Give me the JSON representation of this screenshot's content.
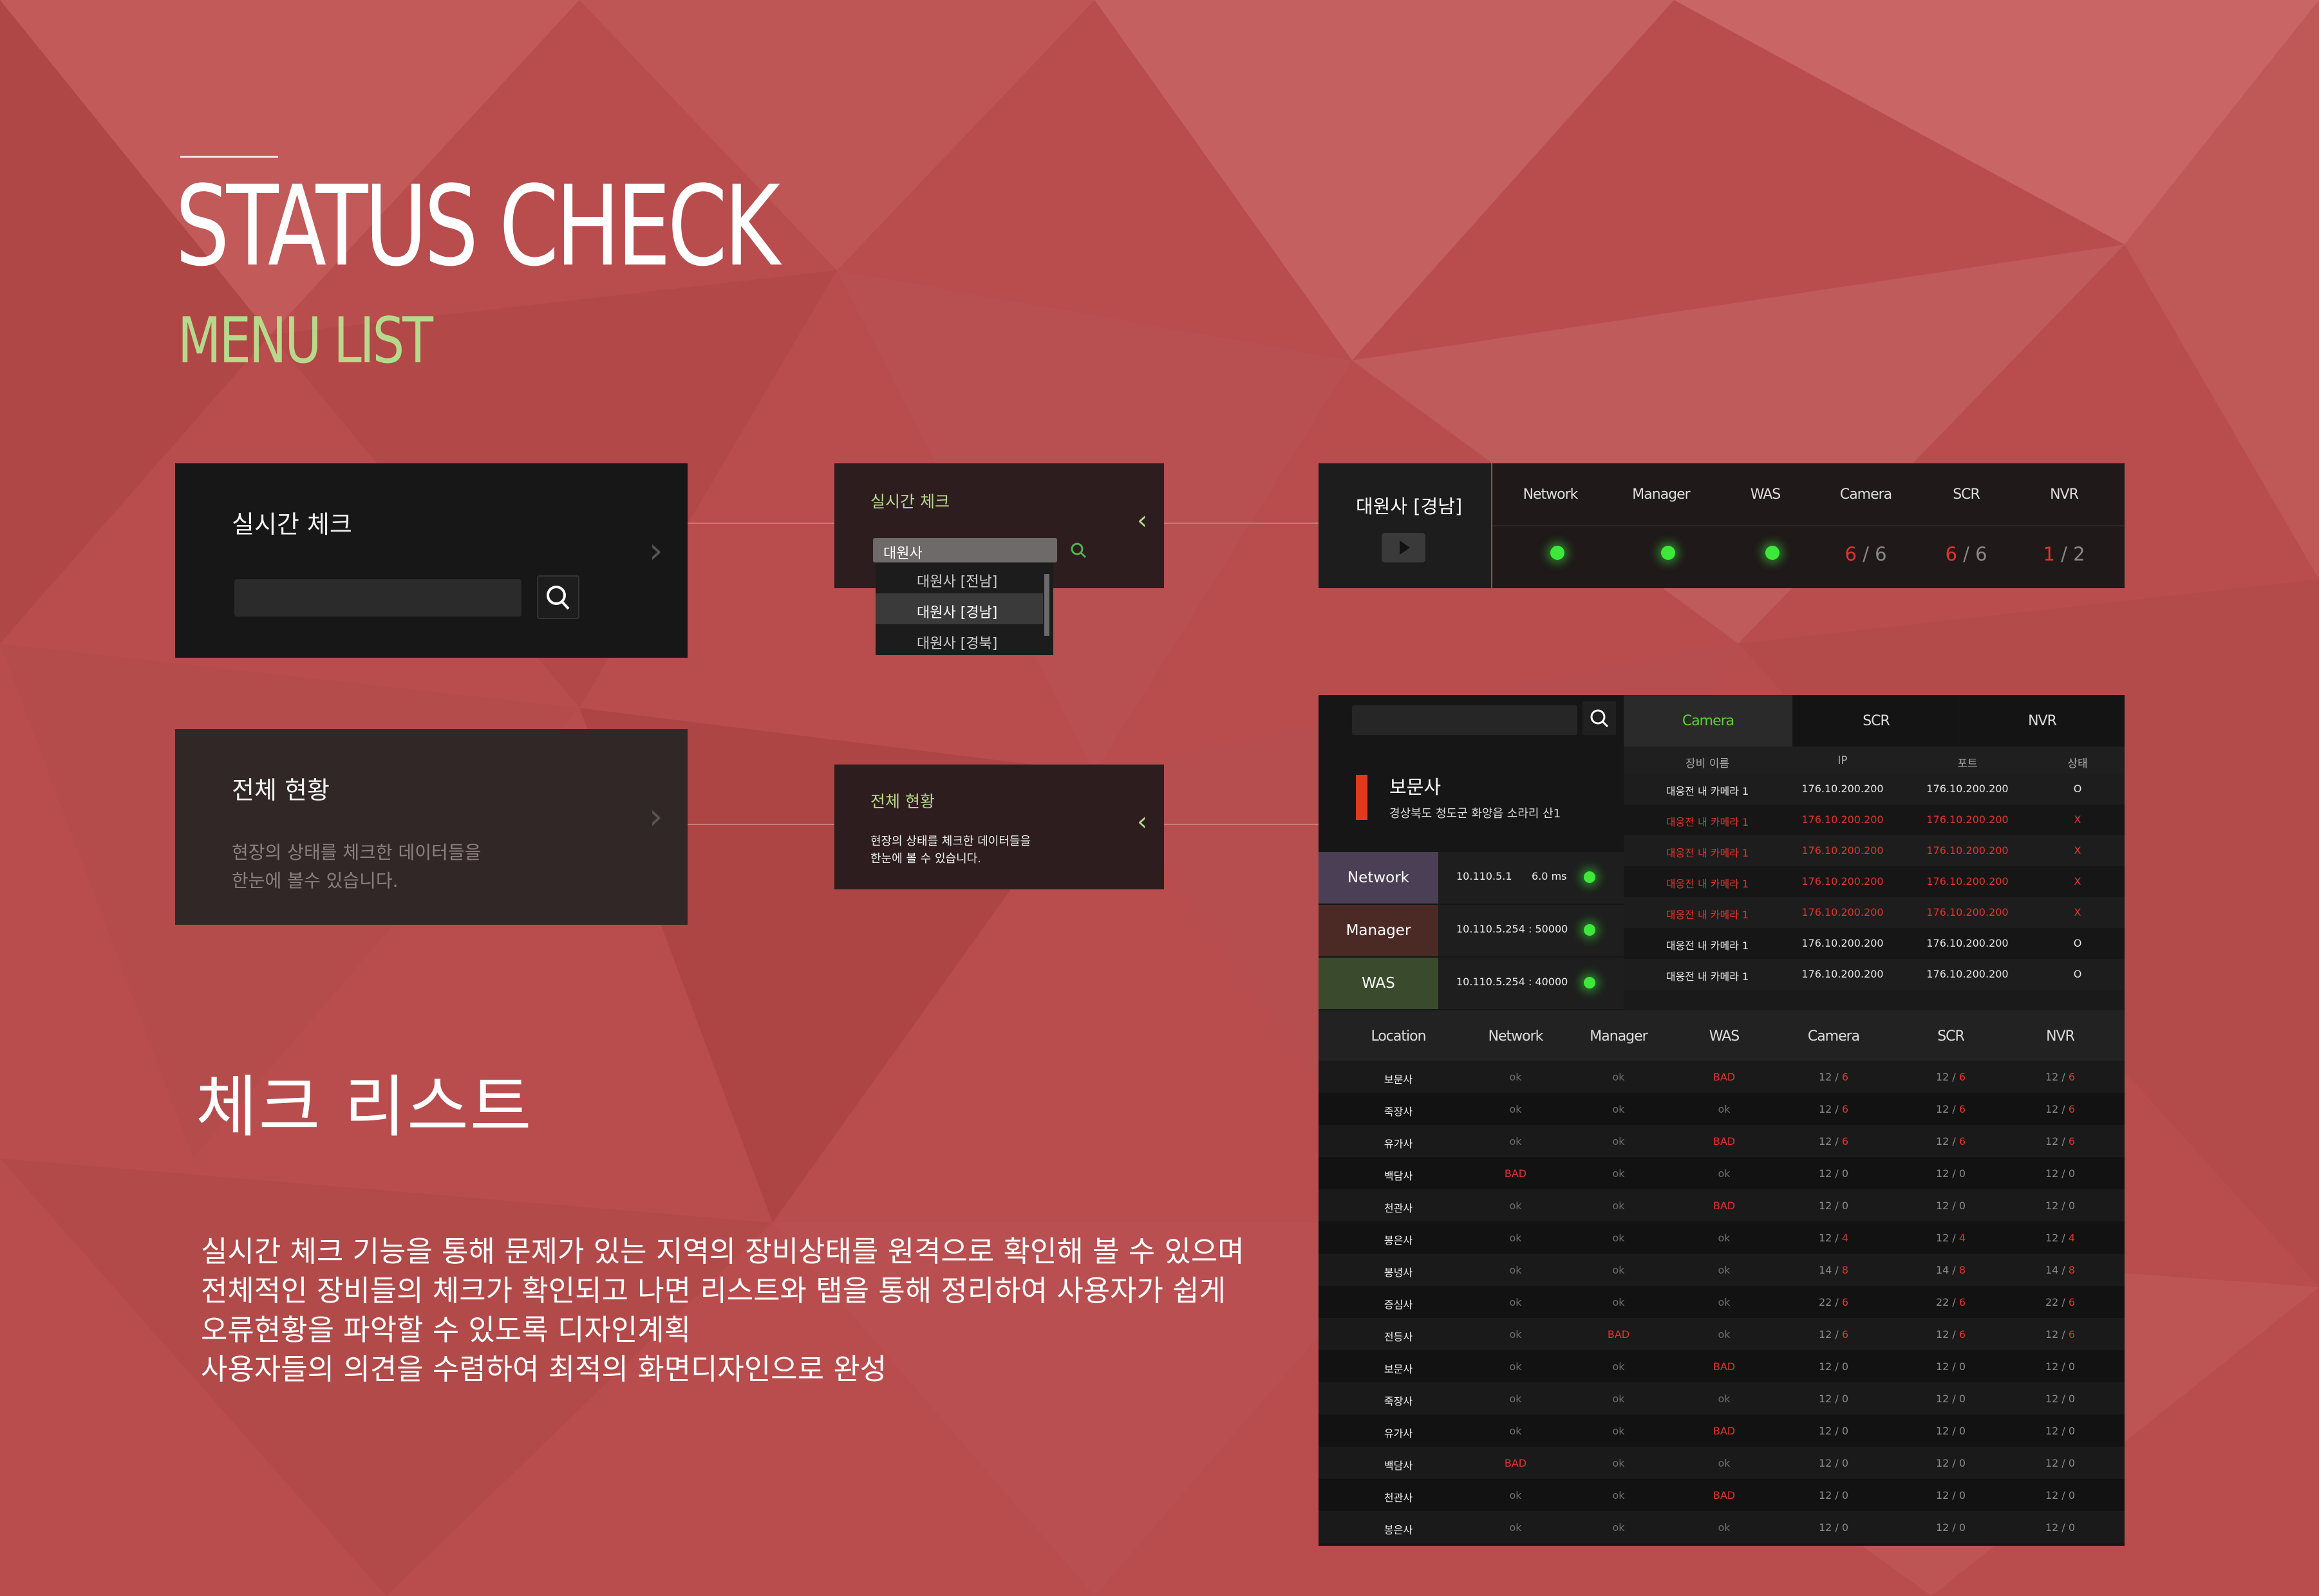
{
  "heading": {
    "title": "STATUS CHECK",
    "subtitle": "MENU LIST",
    "check_title": "체크 리스트",
    "description": [
      "실시간 체크 기능을 통해 문제가 있는 지역의 장비상태를 원격으로 확인해 볼 수 있으며",
      "전체적인 장비들의 체크가 확인되고 나면 리스트와 탭을 통해 정리하여 사용자가 쉽게",
      "오류현황을 파악할 수 있도록 디자인계획",
      "사용자들의 의견을 수렴하여 최적의 화면디자인으로 완성"
    ]
  },
  "realtime_card": {
    "title": "실시간 체크",
    "search_icon": "search-icon",
    "chevron": "›"
  },
  "overview_card": {
    "title": "전체 현황",
    "desc": [
      "현장의 상태를 체크한 데이터들을",
      "한눈에 볼수 있습니다."
    ],
    "chevron": "›"
  },
  "realtime_expanded": {
    "title": "실시간 체크",
    "search_value": "대원사",
    "chevron": "‹",
    "options": [
      "대원사  [전남]",
      "대원사  [경남]",
      "대원사  [경북]"
    ],
    "selected_index": 1
  },
  "overview_expanded": {
    "title": "전체 현황",
    "desc": [
      "현장의 상태를 체크한 데이터들을",
      "한눈에 볼 수 있습니다."
    ],
    "chevron": "‹"
  },
  "status_bar": {
    "site": "대원사  [경남]",
    "columns": [
      "Network",
      "Manager",
      "WAS",
      "Camera",
      "SCR",
      "NVR"
    ],
    "camera": {
      "bad": "6",
      "total": "6"
    },
    "scr": {
      "bad": "6",
      "total": "6"
    },
    "nvr": {
      "bad": "1",
      "total": "2"
    },
    "slash": "/",
    "colors": {
      "ok": "#3ee83b",
      "bad": "#e2342f"
    }
  },
  "detail": {
    "site_name": "보문사",
    "site_address": "경상북도 청도군 화양읍 소라리 산1",
    "services": [
      {
        "name": "Network",
        "value": "10.110.5.1      6.0 ms"
      },
      {
        "name": "Manager",
        "value": "10.110.5.254 : 50000"
      },
      {
        "name": "WAS",
        "value": "10.110.5.254 : 40000"
      }
    ],
    "tabs": [
      "Camera",
      "SCR",
      "NVR"
    ],
    "active_tab": 0,
    "device_headers": [
      "장비 이름",
      "IP",
      "포트",
      "상태"
    ],
    "devices": [
      {
        "name": "대웅전 내 카메라 1",
        "ip": "176.10.200.200",
        "port": "176.10.200.200",
        "status": "O",
        "bad": false
      },
      {
        "name": "대웅전 내 카메라 1",
        "ip": "176.10.200.200",
        "port": "176.10.200.200",
        "status": "X",
        "bad": true
      },
      {
        "name": "대웅전 내 카메라 1",
        "ip": "176.10.200.200",
        "port": "176.10.200.200",
        "status": "X",
        "bad": true
      },
      {
        "name": "대웅전 내 카메라 1",
        "ip": "176.10.200.200",
        "port": "176.10.200.200",
        "status": "X",
        "bad": true
      },
      {
        "name": "대웅전 내 카메라 1",
        "ip": "176.10.200.200",
        "port": "176.10.200.200",
        "status": "X",
        "bad": true
      },
      {
        "name": "대웅전 내 카메라 1",
        "ip": "176.10.200.200",
        "port": "176.10.200.200",
        "status": "O",
        "bad": false
      },
      {
        "name": "대웅전 내 카메라 1",
        "ip": "176.10.200.200",
        "port": "176.10.200.200",
        "status": "O",
        "bad": false
      }
    ],
    "list_headers": [
      "Location",
      "Network",
      "Manager",
      "WAS",
      "Camera",
      "SCR",
      "NVR"
    ],
    "list_rows": [
      [
        "보문사",
        "ok",
        "ok",
        "BAD",
        "12 / 6",
        "12 / 6",
        "12 / 6"
      ],
      [
        "죽장사",
        "ok",
        "ok",
        "ok",
        "12 / 6",
        "12 / 6",
        "12 / 6"
      ],
      [
        "유가사",
        "ok",
        "ok",
        "BAD",
        "12 / 6",
        "12 / 6",
        "12 / 6"
      ],
      [
        "백담사",
        "BAD",
        "ok",
        "ok",
        "12 / 0",
        "12 / 0",
        "12 / 0"
      ],
      [
        "천관사",
        "ok",
        "ok",
        "BAD",
        "12 / 0",
        "12 / 0",
        "12 / 0"
      ],
      [
        "봉은사",
        "ok",
        "ok",
        "ok",
        "12 / 4",
        "12 / 4",
        "12 / 4"
      ],
      [
        "봉녕사",
        "ok",
        "ok",
        "ok",
        "14 / 8",
        "14 / 8",
        "14 / 8"
      ],
      [
        "증심사",
        "ok",
        "ok",
        "ok",
        "22 / 6",
        "22 / 6",
        "22 / 6"
      ],
      [
        "전등사",
        "ok",
        "BAD",
        "ok",
        "12 / 6",
        "12 / 6",
        "12 / 6"
      ],
      [
        "보문사",
        "ok",
        "ok",
        "BAD",
        "12 / 0",
        "12 / 0",
        "12 / 0"
      ],
      [
        "죽장사",
        "ok",
        "ok",
        "ok",
        "12 / 0",
        "12 / 0",
        "12 / 0"
      ],
      [
        "유가사",
        "ok",
        "ok",
        "BAD",
        "12 / 0",
        "12 / 0",
        "12 / 0"
      ],
      [
        "백담사",
        "BAD",
        "ok",
        "ok",
        "12 / 0",
        "12 / 0",
        "12 / 0"
      ],
      [
        "천관사",
        "ok",
        "ok",
        "BAD",
        "12 / 0",
        "12 / 0",
        "12 / 0"
      ],
      [
        "봉은사",
        "ok",
        "ok",
        "ok",
        "12 / 0",
        "12 / 0",
        "12 / 0"
      ]
    ]
  }
}
